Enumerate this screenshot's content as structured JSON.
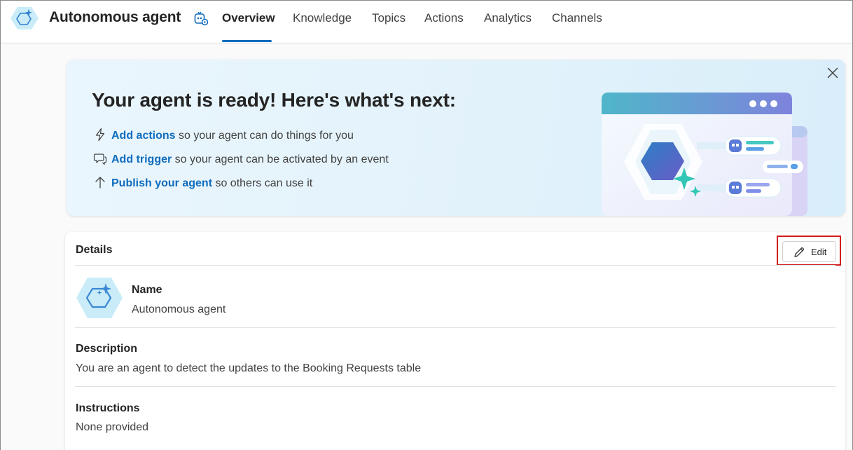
{
  "header": {
    "agent_name": "Autonomous agent",
    "tabs": [
      {
        "label": "Overview",
        "active": true
      },
      {
        "label": "Knowledge",
        "active": false
      },
      {
        "label": "Topics",
        "active": false
      },
      {
        "label": "Actions",
        "active": false
      },
      {
        "label": "Analytics",
        "active": false
      },
      {
        "label": "Channels",
        "active": false
      }
    ]
  },
  "banner": {
    "title": "Your agent is ready! Here's what's next:",
    "items": [
      {
        "icon": "lightning-icon",
        "link": "Add actions",
        "text": " so your agent can do things for you"
      },
      {
        "icon": "chat-trigger-icon",
        "link": "Add trigger",
        "text": " so your agent can be activated by an event"
      },
      {
        "icon": "arrow-up-icon",
        "link": "Publish your agent",
        "text": " so others can use it"
      }
    ]
  },
  "details": {
    "title": "Details",
    "edit_label": "Edit",
    "name_label": "Name",
    "name_value": "Autonomous agent",
    "description_label": "Description",
    "description_value": "You are an agent to detect the updates to the Booking Requests table",
    "instructions_label": "Instructions",
    "instructions_value": "None provided"
  },
  "colors": {
    "accent": "#0f6cbd",
    "highlight_box": "#d21e1e",
    "banner_bg": "#e2f2fb"
  }
}
